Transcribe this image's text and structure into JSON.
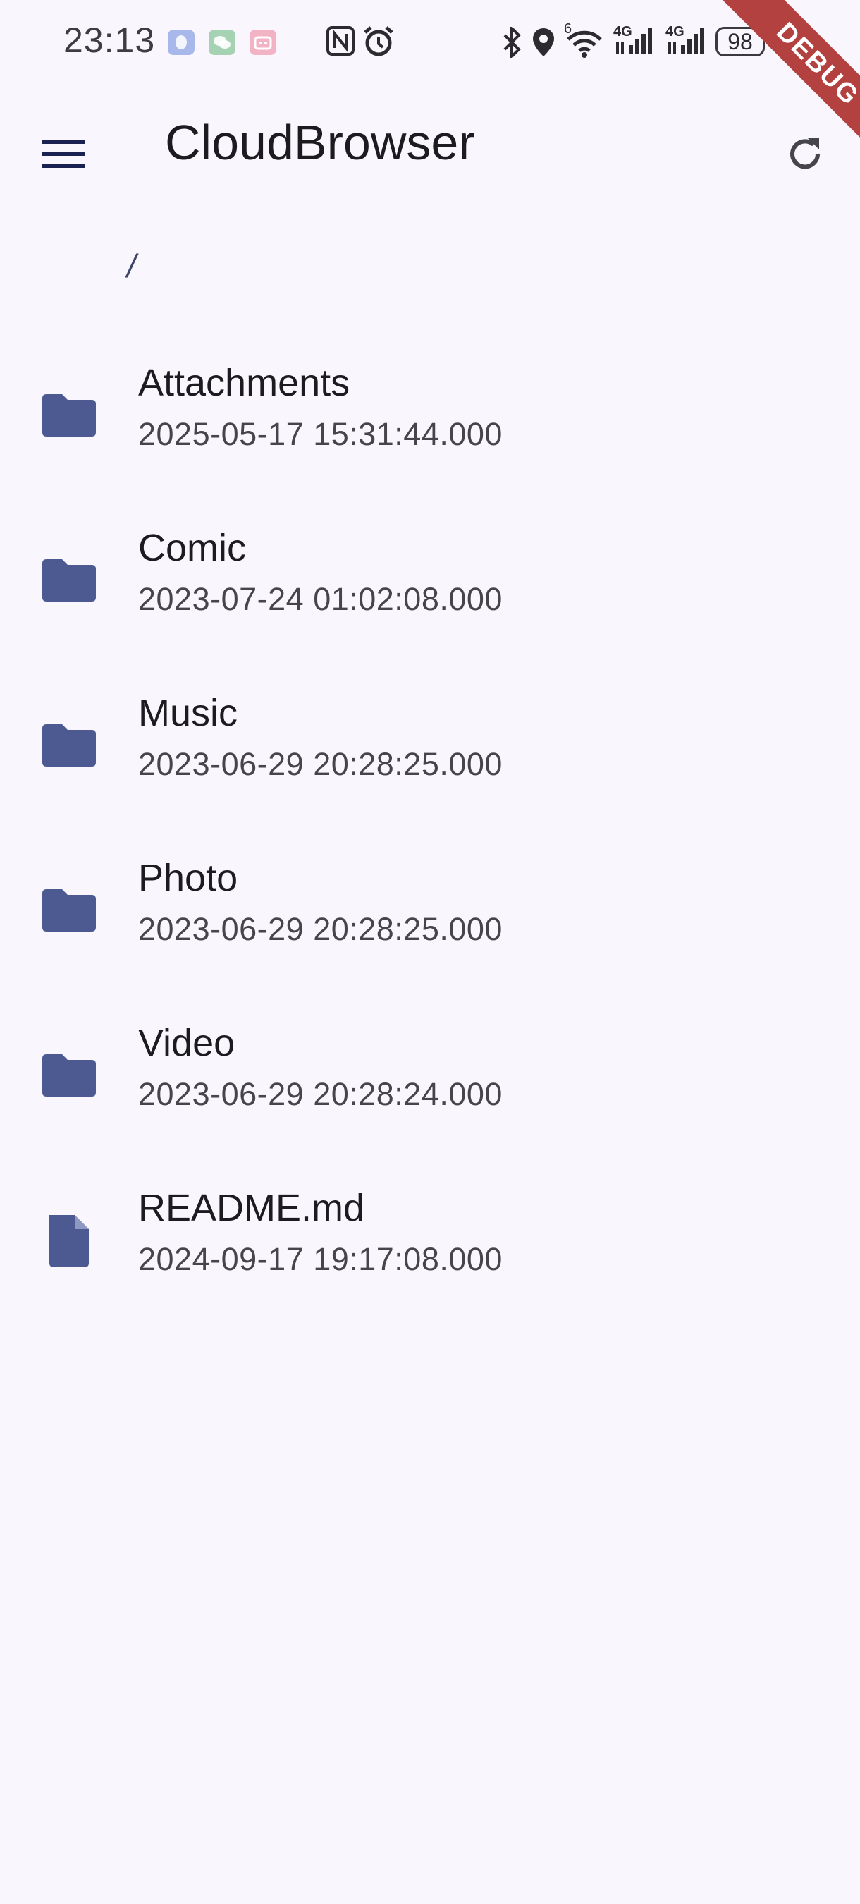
{
  "status_bar": {
    "time": "23:13",
    "network_1": "4G",
    "network_2": "4G",
    "wifi_badge": "6",
    "battery": "98",
    "icons": [
      "qq-icon",
      "wechat-icon",
      "bilibili-icon",
      "nfc-icon",
      "alarm-icon",
      "bluetooth-icon",
      "location-icon",
      "wifi-icon",
      "signal-icon",
      "signal-icon",
      "battery-icon"
    ]
  },
  "app_bar": {
    "title": "CloudBrowser",
    "menu_icon": "hamburger-menu-icon",
    "refresh_icon": "refresh-icon"
  },
  "breadcrumb": {
    "path": "/"
  },
  "files": [
    {
      "name": "Attachments",
      "date": "2025-05-17 15:31:44.000",
      "type": "folder"
    },
    {
      "name": "Comic",
      "date": "2023-07-24 01:02:08.000",
      "type": "folder"
    },
    {
      "name": "Music",
      "date": "2023-06-29 20:28:25.000",
      "type": "folder"
    },
    {
      "name": "Photo",
      "date": "2023-06-29 20:28:25.000",
      "type": "folder"
    },
    {
      "name": "Video",
      "date": "2023-06-29 20:28:24.000",
      "type": "folder"
    },
    {
      "name": "README.md",
      "date": "2024-09-17 19:17:08.000",
      "type": "file"
    }
  ],
  "debug_banner": "DEBUG",
  "colors": {
    "background": "#f9f6fd",
    "icon": "#4c5a91",
    "menu_icon": "#1b2150",
    "debug": "#b3413f"
  }
}
